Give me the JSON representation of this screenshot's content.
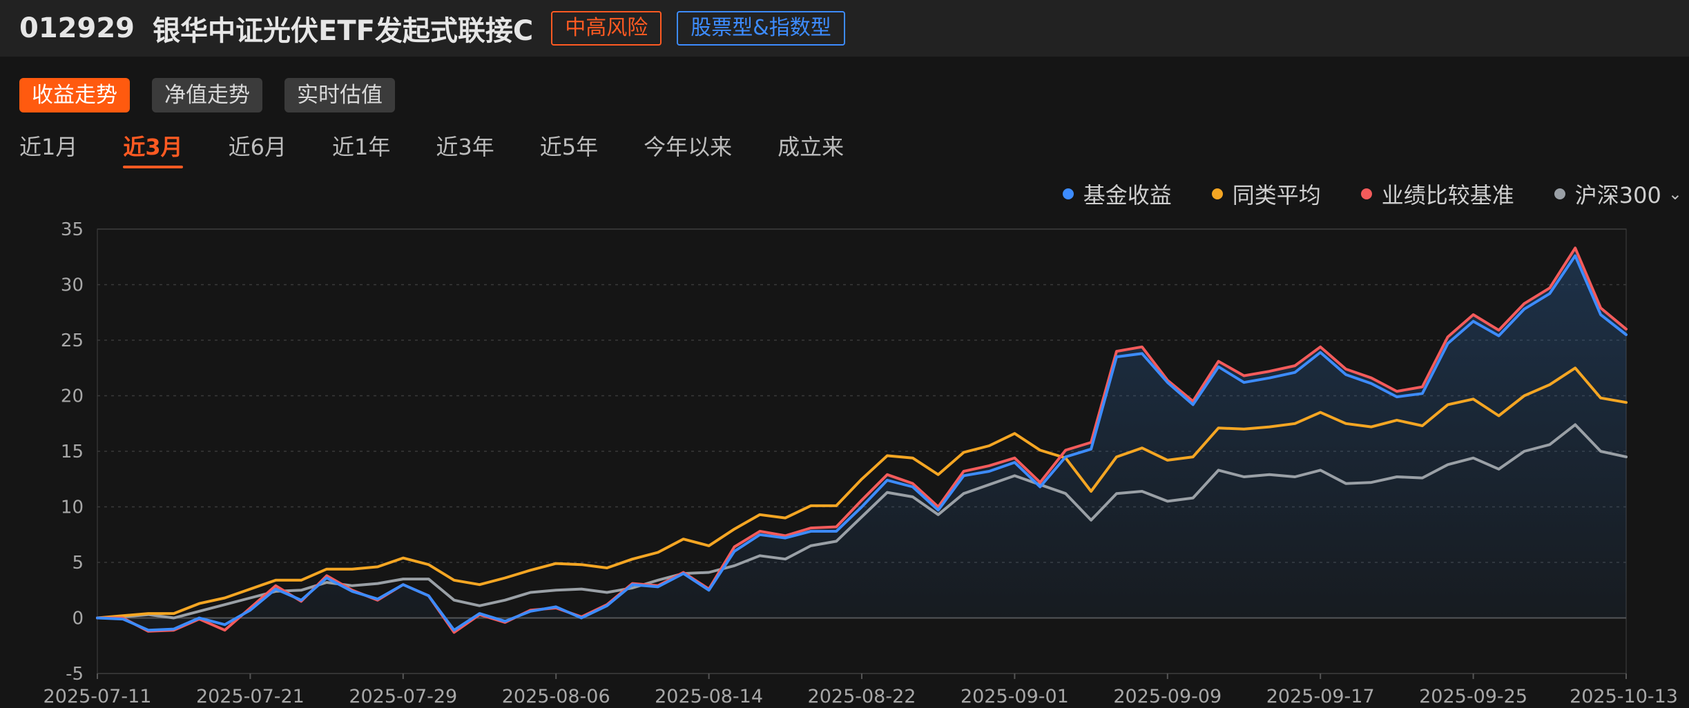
{
  "header": {
    "fund_code": "012929",
    "fund_name": "银华中证光伏ETF发起式联接C",
    "risk_tag": "中高风险",
    "type_tag": "股票型&指数型"
  },
  "view_tabs": [
    "收益走势",
    "净值走势",
    "实时估值"
  ],
  "active_view_tab": 0,
  "period_tabs": [
    "近1月",
    "近3月",
    "近6月",
    "近1年",
    "近3年",
    "近5年",
    "今年以来",
    "成立来"
  ],
  "active_period_tab": 1,
  "legend_chevron": "⌄",
  "colors": {
    "fund": "#3d8cff",
    "category": "#f5a623",
    "benchmark": "#f45b5b",
    "hs300": "#9aa0a6",
    "grid": "#3a3a3a",
    "axis_text": "#a8a8a8"
  },
  "chart_data": {
    "type": "line",
    "x_tick_labels": [
      "2025-07-11",
      "2025-07-21",
      "2025-07-29",
      "2025-08-06",
      "2025-08-14",
      "2025-08-22",
      "2025-09-01",
      "2025-09-09",
      "2025-09-17",
      "2025-09-25",
      "2025-10-13"
    ],
    "ylim": [
      -5,
      35
    ],
    "y_ticks": [
      -5,
      0,
      5,
      10,
      15,
      20,
      25,
      30,
      35
    ],
    "legend_position": "top-right",
    "grid": true,
    "series": [
      {
        "name": "基金收益",
        "color": "#3d8cff",
        "values": [
          0,
          -0.1,
          -1.1,
          -1,
          0,
          -0.6,
          0.7,
          2.6,
          1.6,
          3.6,
          2.4,
          1.7,
          3,
          2,
          -1.1,
          0.4,
          -0.3,
          0.6,
          1,
          0,
          1.1,
          3,
          2.8,
          4,
          2.5,
          6,
          7.5,
          7.2,
          7.8,
          7.8,
          10,
          12.4,
          11.8,
          9.7,
          12.8,
          13.2,
          14,
          11.8,
          14.5,
          15.2,
          23.5,
          23.8,
          21.2,
          19.2,
          22.6,
          21.2,
          21.6,
          22.1,
          23.9,
          21.9,
          21.1,
          19.9,
          20.2,
          24.7,
          26.7,
          25.4,
          27.8,
          29.2,
          32.6,
          27.3,
          25.5
        ]
      },
      {
        "name": "同类平均",
        "color": "#f5a623",
        "values": [
          0,
          0.2,
          0.4,
          0.4,
          1.3,
          1.8,
          2.6,
          3.4,
          3.4,
          4.4,
          4.4,
          4.6,
          5.4,
          4.8,
          3.4,
          3,
          3.6,
          4.3,
          4.9,
          4.8,
          4.5,
          5.3,
          5.9,
          7.1,
          6.5,
          8,
          9.3,
          9,
          10.1,
          10.1,
          12.5,
          14.6,
          14.4,
          12.9,
          14.9,
          15.5,
          16.6,
          15.1,
          14.4,
          11.4,
          14.5,
          15.3,
          14.2,
          14.5,
          17.1,
          17,
          17.2,
          17.5,
          18.5,
          17.5,
          17.2,
          17.8,
          17.3,
          19.2,
          19.7,
          18.2,
          20,
          21,
          22.5,
          19.8,
          19.4
        ]
      },
      {
        "name": "业绩比较基准",
        "color": "#f45b5b",
        "values": [
          0,
          0,
          -1.2,
          -1.1,
          -0.1,
          -1.1,
          0.9,
          2.9,
          1.5,
          3.8,
          2.5,
          1.6,
          3,
          2,
          -1.3,
          0.3,
          -0.4,
          0.7,
          0.9,
          0.1,
          1.2,
          3.1,
          2.9,
          4.1,
          2.6,
          6.4,
          7.8,
          7.4,
          8.1,
          8.2,
          10.6,
          12.9,
          12.1,
          10,
          13.2,
          13.7,
          14.4,
          12.2,
          15.1,
          15.8,
          24,
          24.4,
          21.4,
          19.5,
          23.1,
          21.8,
          22.2,
          22.7,
          24.4,
          22.4,
          21.6,
          20.4,
          20.8,
          25.3,
          27.3,
          25.9,
          28.3,
          29.7,
          33.3,
          27.9,
          26
        ]
      },
      {
        "name": "沪深300",
        "color": "#9aa0a6",
        "values": [
          0,
          0.1,
          0.3,
          0,
          0.6,
          1.2,
          1.8,
          2.4,
          2.5,
          3.2,
          2.9,
          3.1,
          3.5,
          3.5,
          1.6,
          1.1,
          1.6,
          2.3,
          2.5,
          2.6,
          2.3,
          2.7,
          3.4,
          4,
          4.1,
          4.7,
          5.6,
          5.3,
          6.5,
          6.9,
          9.1,
          11.3,
          10.9,
          9.3,
          11.2,
          12,
          12.8,
          12,
          11.2,
          8.8,
          11.2,
          11.4,
          10.5,
          10.8,
          13.3,
          12.7,
          12.9,
          12.7,
          13.3,
          12.1,
          12.2,
          12.7,
          12.6,
          13.8,
          14.4,
          13.4,
          15,
          15.6,
          17.4,
          15,
          14.5
        ]
      }
    ]
  }
}
